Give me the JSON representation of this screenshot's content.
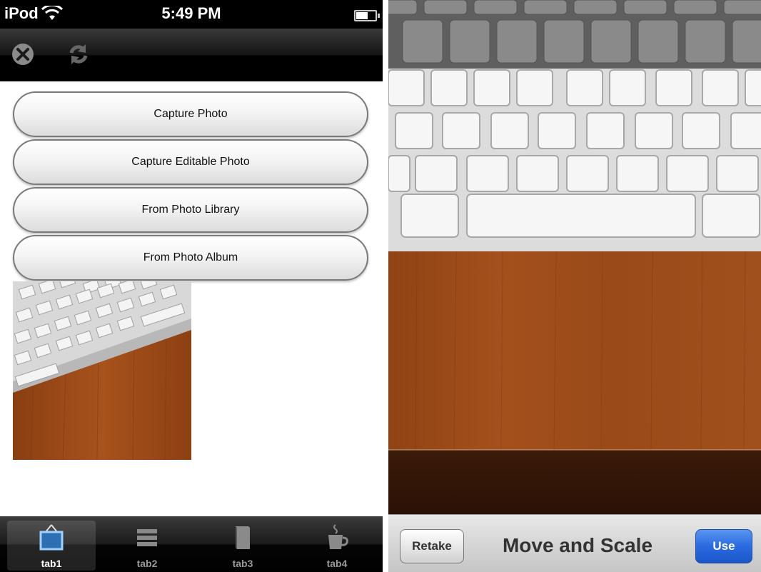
{
  "left": {
    "status_bar": {
      "device": "iPod",
      "time": "5:49 PM"
    },
    "toolbar": {
      "icons": [
        "close-icon",
        "refresh-icon"
      ]
    },
    "buttons": [
      {
        "label": "Capture Photo"
      },
      {
        "label": "Capture Editable Photo"
      },
      {
        "label": "From Photo Library"
      },
      {
        "label": "From Photo Album"
      }
    ],
    "tabs": [
      {
        "label": "tab1",
        "icon": "picture-frame-icon",
        "active": true
      },
      {
        "label": "tab2",
        "icon": "list-icon",
        "active": false
      },
      {
        "label": "tab3",
        "icon": "book-icon",
        "active": false
      },
      {
        "label": "tab4",
        "icon": "coffee-cup-icon",
        "active": false
      }
    ]
  },
  "right": {
    "crop_bar": {
      "retake_label": "Retake",
      "title": "Move and Scale",
      "use_label": "Use"
    }
  },
  "colors": {
    "use_button": "#2a6ae0",
    "toolbar": "#000000",
    "wood": "#9a4a1c"
  }
}
